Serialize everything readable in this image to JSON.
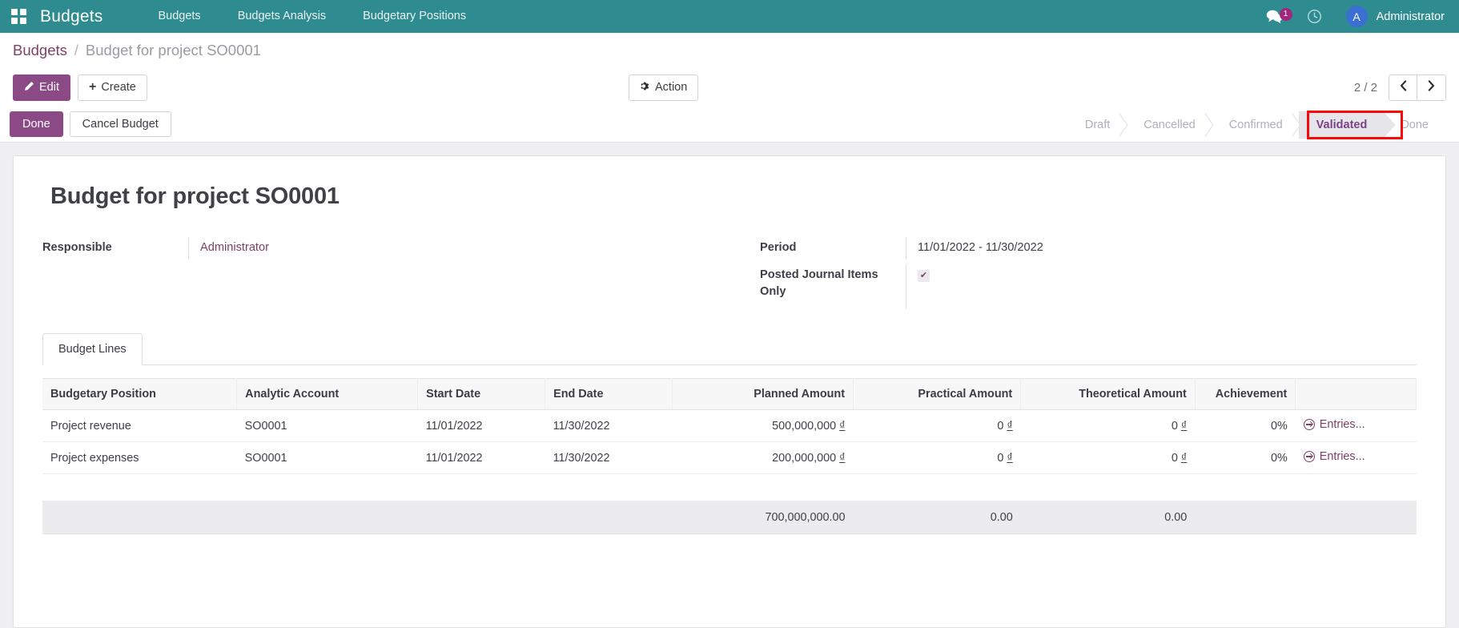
{
  "navbar": {
    "apps_icon": "apps-grid-icon",
    "brand": "Budgets",
    "menu": [
      {
        "label": "Budgets"
      },
      {
        "label": "Budgets Analysis"
      },
      {
        "label": "Budgetary Positions"
      }
    ],
    "messages_icon": "messages-icon",
    "messages_count": "1",
    "activity_icon": "clock-icon",
    "avatar_initial": "A",
    "user_name": "Administrator",
    "accent_color": "#2e8b8f",
    "badge_color": "#a2257f"
  },
  "breadcrumb": {
    "root": "Budgets",
    "separator": "/",
    "current": "Budget for project SO0001"
  },
  "control_panel": {
    "edit_label": "Edit",
    "edit_icon": "pencil-icon",
    "create_label": "Create",
    "create_icon": "plus-icon",
    "action_label": "Action",
    "action_icon": "gear-icon",
    "pager_text": "2 / 2",
    "prev_icon": "chevron-left-icon",
    "next_icon": "chevron-right-icon"
  },
  "statusbar": {
    "buttons": [
      {
        "label": "Done",
        "style": "primary"
      },
      {
        "label": "Cancel Budget",
        "style": "secondary"
      }
    ],
    "stages": [
      {
        "label": "Draft",
        "active": false
      },
      {
        "label": "Cancelled",
        "active": false
      },
      {
        "label": "Confirmed",
        "active": false
      },
      {
        "label": "Validated",
        "active": true
      },
      {
        "label": "Done",
        "active": false
      }
    ],
    "highlight_color": "#f60b0b",
    "active_color": "#7d3f85"
  },
  "record": {
    "title": "Budget for project SO0001",
    "fields_left": [
      {
        "label": "Responsible",
        "value": "Administrator",
        "type": "link"
      }
    ],
    "fields_right": [
      {
        "label": "Period",
        "value": "11/01/2022 - 11/30/2022",
        "type": "text"
      },
      {
        "label": "Posted Journal Items Only",
        "value": "✔",
        "type": "checkbox"
      }
    ]
  },
  "notebook": {
    "tabs": [
      {
        "label": "Budget Lines",
        "active": true
      }
    ]
  },
  "table": {
    "columns": [
      "Budgetary Position",
      "Analytic Account",
      "Start Date",
      "End Date",
      "Planned Amount",
      "Practical Amount",
      "Theoretical Amount",
      "Achievement"
    ],
    "rows": [
      {
        "budgetary_position": "Project revenue",
        "analytic_account": "SO0001",
        "start_date": "11/01/2022",
        "end_date": "11/30/2022",
        "planned_amount": "500,000,000",
        "planned_currency": "₫",
        "practical_amount": "0",
        "practical_currency": "₫",
        "theoretical_amount": "0",
        "theoretical_currency": "₫",
        "achievement": "0%",
        "entries_label": "Entries...",
        "entries_icon": "arrow-circle-right-icon"
      },
      {
        "budgetary_position": "Project expenses",
        "analytic_account": "SO0001",
        "start_date": "11/01/2022",
        "end_date": "11/30/2022",
        "planned_amount": "200,000,000",
        "planned_currency": "₫",
        "practical_amount": "0",
        "practical_currency": "₫",
        "theoretical_amount": "0",
        "theoretical_currency": "₫",
        "achievement": "0%",
        "entries_label": "Entries...",
        "entries_icon": "arrow-circle-right-icon"
      }
    ],
    "totals": {
      "planned_amount": "700,000,000.00",
      "practical_amount": "0.00",
      "theoretical_amount": "0.00"
    }
  }
}
